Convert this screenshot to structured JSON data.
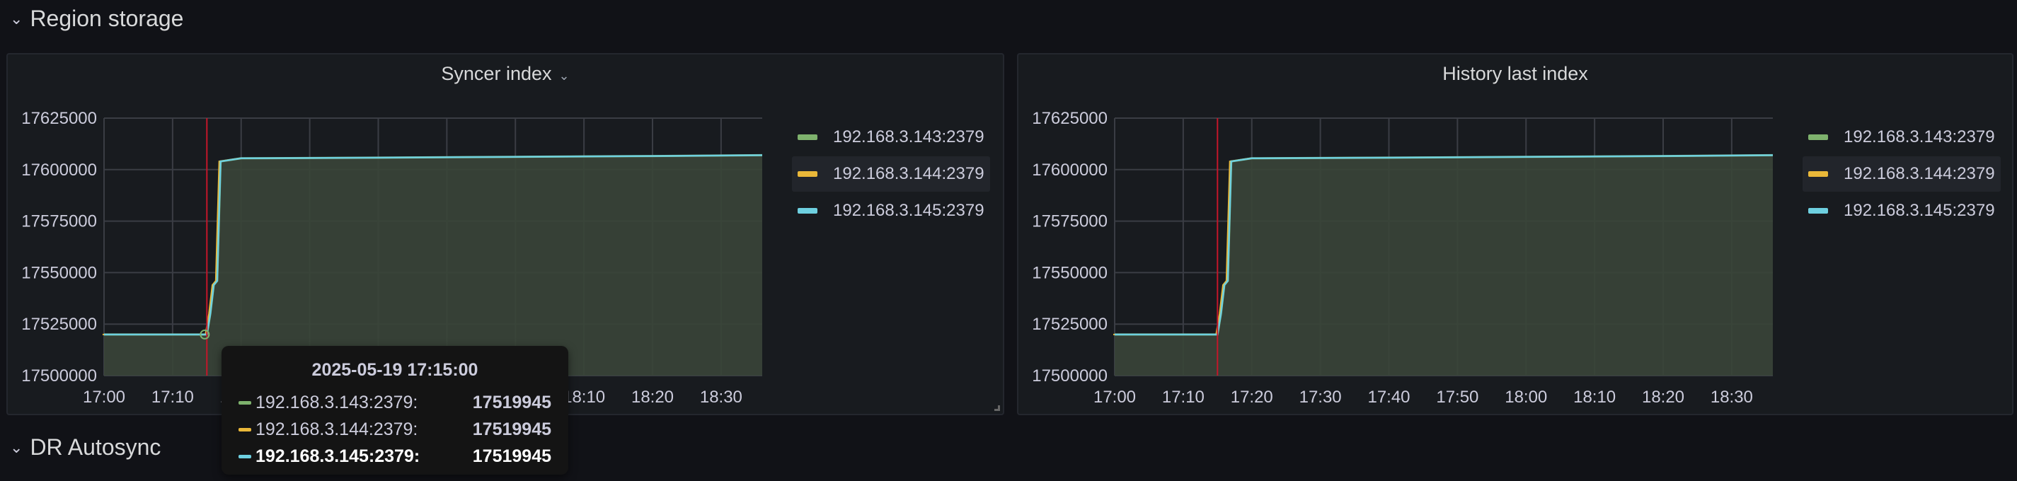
{
  "rows": [
    {
      "label": "Region storage"
    },
    {
      "label": "DR Autosync"
    }
  ],
  "colors": {
    "143": "#7eb26d",
    "144": "#eab839",
    "145": "#6ed0e0",
    "fill": "#3a4539",
    "cursor": "#c4162a"
  },
  "panels": [
    {
      "title": "Syncer index",
      "has_menu": true,
      "legend": [
        "192.168.3.143:2379",
        "192.168.3.144:2379",
        "192.168.3.145:2379"
      ]
    },
    {
      "title": "History last index",
      "has_menu": false,
      "legend": [
        "192.168.3.143:2379",
        "192.168.3.144:2379",
        "192.168.3.145:2379"
      ]
    }
  ],
  "tooltip": {
    "time": "2025-05-19 17:15:00",
    "rows": [
      {
        "name": "192.168.3.143:2379:",
        "value": "17519945"
      },
      {
        "name": "192.168.3.144:2379:",
        "value": "17519945"
      },
      {
        "name": "192.168.3.145:2379:",
        "value": "17519945"
      }
    ]
  },
  "chart_data": [
    {
      "type": "area",
      "title": "Syncer index",
      "ylim": [
        17500000,
        17625000
      ],
      "yticks": [
        "17500000",
        "17525000",
        "17550000",
        "17575000",
        "17600000",
        "17625000"
      ],
      "xlim_minutes": [
        0,
        96
      ],
      "x_start": "17:00",
      "xticks": [
        "17:00",
        "17:10",
        "17:20",
        "17:30",
        "17:40",
        "17:50",
        "18:00",
        "18:10",
        "18:20",
        "18:30"
      ],
      "cursor_minute": 15,
      "series": [
        {
          "name": "192.168.3.145:2379",
          "x": [
            0,
            15,
            15.5,
            16,
            16.5,
            17,
            20,
            40,
            60,
            80,
            96
          ],
          "y": [
            17519945,
            17519945,
            17530000,
            17544000,
            17546000,
            17604000,
            17605500,
            17605800,
            17606200,
            17606600,
            17607000
          ]
        }
      ]
    },
    {
      "type": "area",
      "title": "History last index",
      "ylim": [
        17500000,
        17625000
      ],
      "yticks": [
        "17500000",
        "17525000",
        "17550000",
        "17575000",
        "17600000",
        "17625000"
      ],
      "xlim_minutes": [
        0,
        96
      ],
      "x_start": "17:00",
      "xticks": [
        "17:00",
        "17:10",
        "17:20",
        "17:30",
        "17:40",
        "17:50",
        "18:00",
        "18:10",
        "18:20",
        "18:30"
      ],
      "cursor_minute": 15,
      "series": [
        {
          "name": "192.168.3.145:2379",
          "x": [
            0,
            15,
            15.5,
            16,
            16.5,
            17,
            20,
            40,
            60,
            80,
            96
          ],
          "y": [
            17519945,
            17519945,
            17530000,
            17544000,
            17546000,
            17604000,
            17605500,
            17605800,
            17606200,
            17606600,
            17607000
          ]
        }
      ]
    }
  ]
}
